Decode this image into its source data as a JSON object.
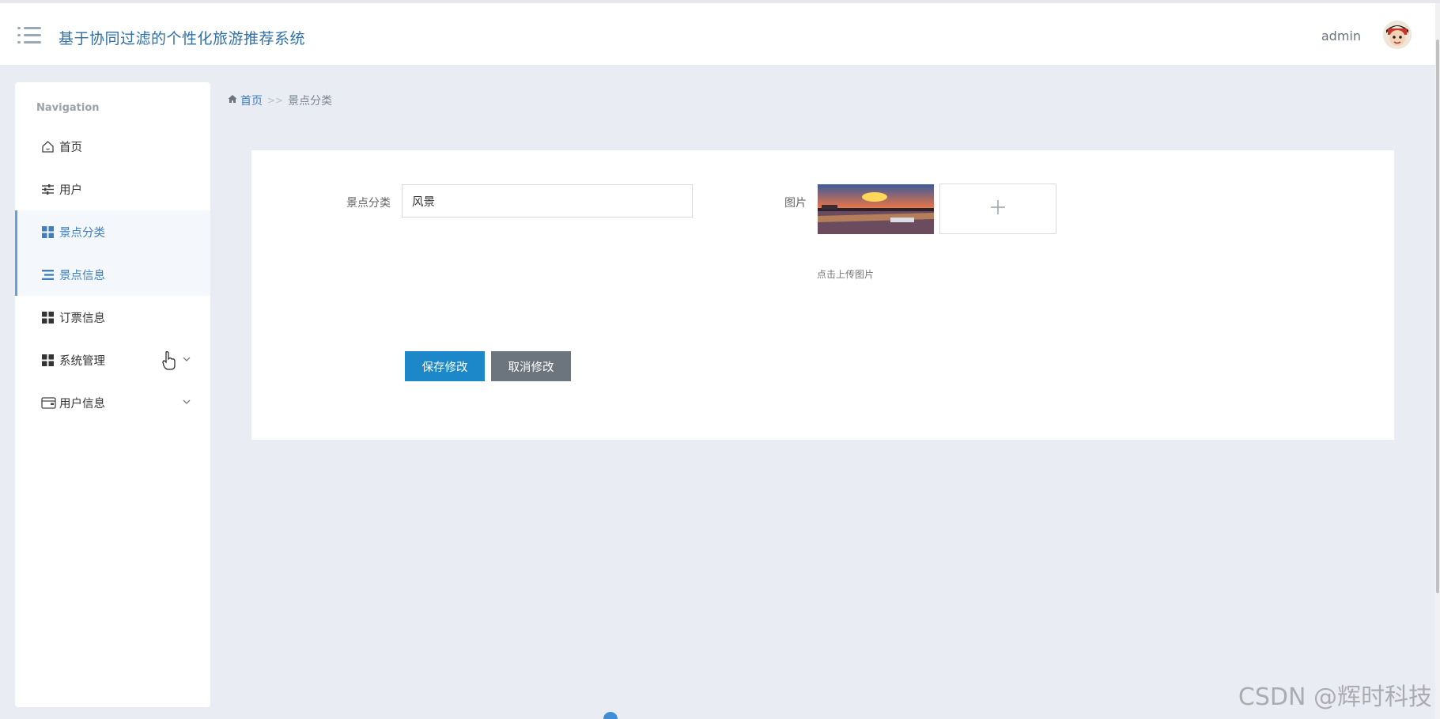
{
  "header": {
    "app_title": "基于协同过滤的个性化旅游推荐系统",
    "user_name": "admin"
  },
  "sidebar": {
    "caption": "Navigation",
    "items": [
      {
        "label": "首页",
        "icon": "home-icon"
      },
      {
        "label": "用户",
        "icon": "sliders-icon"
      },
      {
        "label": "景点分类",
        "icon": "grid-icon",
        "active": true
      },
      {
        "label": "景点信息",
        "icon": "list-icon",
        "active": true
      },
      {
        "label": "订票信息",
        "icon": "grid-icon"
      },
      {
        "label": "系统管理",
        "icon": "grid-icon",
        "expandable": true
      },
      {
        "label": "用户信息",
        "icon": "wallet-icon",
        "expandable": true
      }
    ]
  },
  "breadcrumb": {
    "home": "首页",
    "separator": ">>",
    "current": "景点分类"
  },
  "form": {
    "category_label": "景点分类",
    "category_value": "风景",
    "image_label": "图片",
    "upload_hint": "点击上传图片",
    "save_label": "保存修改",
    "cancel_label": "取消修改"
  },
  "watermark": "CSDN @辉时科技",
  "colors": {
    "accent": "#3f7fbf",
    "save_button": "#1c87c9",
    "cancel_button": "#6c757d",
    "background": "#e9ecf3"
  }
}
